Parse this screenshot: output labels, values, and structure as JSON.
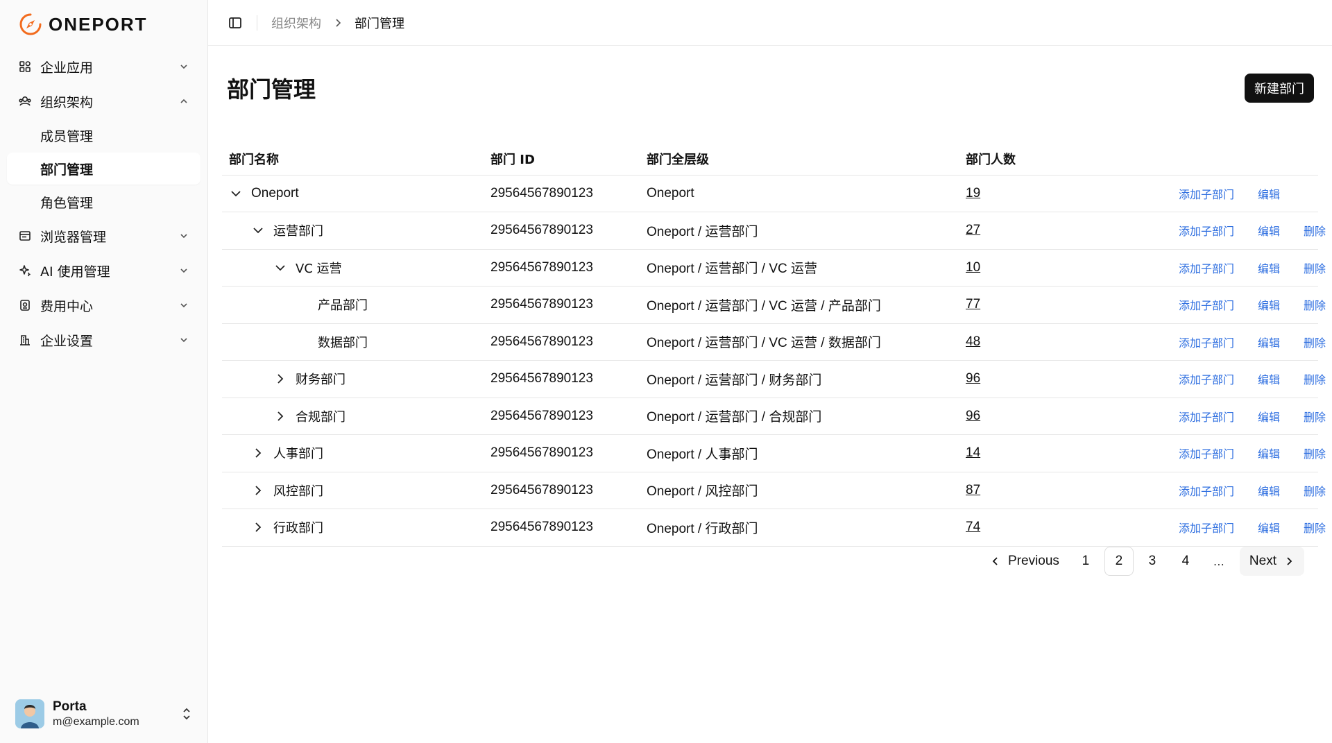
{
  "app": {
    "logo_text": "ONEPORT",
    "brand_color": "#f26b1d"
  },
  "sidebar": {
    "items": [
      {
        "label": "企业应用",
        "icon": "apps-grid-icon"
      },
      {
        "label": "组织架构",
        "icon": "org-users-icon",
        "expanded": true,
        "children": [
          {
            "label": "成员管理"
          },
          {
            "label": "部门管理",
            "active": true
          },
          {
            "label": "角色管理"
          }
        ]
      },
      {
        "label": "浏览器管理",
        "icon": "browser-window-icon"
      },
      {
        "label": "AI 使用管理",
        "icon": "sparkle-icon"
      },
      {
        "label": "费用中心",
        "icon": "receipt-icon"
      },
      {
        "label": "企业设置",
        "icon": "building-icon"
      }
    ]
  },
  "user": {
    "name": "Porta",
    "email": "m@example.com"
  },
  "breadcrumb": {
    "parent": "组织架构",
    "current": "部门管理"
  },
  "page": {
    "title": "部门管理",
    "new_button": "新建部门"
  },
  "table": {
    "columns": [
      "部门名称",
      "部门 ID",
      "部门全层级",
      "部门人数"
    ],
    "action_labels": {
      "add_child": "添加子部门",
      "edit": "编辑",
      "delete": "删除"
    },
    "rows": [
      {
        "name": "Oneport",
        "id": "29564567890123",
        "path": "Oneport",
        "count": "19",
        "level": 0,
        "toggle": "expanded",
        "deletable": false
      },
      {
        "name": "运营部门",
        "id": "29564567890123",
        "path": "Oneport / 运营部门",
        "count": "27",
        "level": 1,
        "toggle": "expanded",
        "deletable": true
      },
      {
        "name": "VC 运营",
        "id": "29564567890123",
        "path": "Oneport / 运营部门 / VC 运营",
        "count": "10",
        "level": 2,
        "toggle": "expanded",
        "deletable": true
      },
      {
        "name": "产品部门",
        "id": "29564567890123",
        "path": "Oneport / 运营部门 / VC 运营 / 产品部门",
        "count": "77",
        "level": 3,
        "toggle": "none",
        "deletable": true
      },
      {
        "name": "数据部门",
        "id": "29564567890123",
        "path": "Oneport / 运营部门 / VC 运营 / 数据部门",
        "count": "48",
        "level": 3,
        "toggle": "none",
        "deletable": true
      },
      {
        "name": "财务部门",
        "id": "29564567890123",
        "path": "Oneport / 运营部门 / 财务部门",
        "count": "96",
        "level": 2,
        "toggle": "collapsed",
        "deletable": true
      },
      {
        "name": "合规部门",
        "id": "29564567890123",
        "path": "Oneport / 运营部门 / 合规部门",
        "count": "96",
        "level": 2,
        "toggle": "collapsed",
        "deletable": true
      },
      {
        "name": "人事部门",
        "id": "29564567890123",
        "path": "Oneport / 人事部门",
        "count": "14",
        "level": 1,
        "toggle": "collapsed",
        "deletable": true
      },
      {
        "name": "风控部门",
        "id": "29564567890123",
        "path": "Oneport / 风控部门",
        "count": "87",
        "level": 1,
        "toggle": "collapsed",
        "deletable": true
      },
      {
        "name": "行政部门",
        "id": "29564567890123",
        "path": "Oneport / 行政部门",
        "count": "74",
        "level": 1,
        "toggle": "collapsed",
        "deletable": true
      }
    ]
  },
  "pagination": {
    "previous": "Previous",
    "next": "Next",
    "pages": [
      "1",
      "2",
      "3",
      "4"
    ],
    "current": "2",
    "ellipsis": "…"
  },
  "colors": {
    "primary_button": "#111111",
    "link": "#2f6fe0",
    "sidebar_bg": "#fafafa"
  }
}
